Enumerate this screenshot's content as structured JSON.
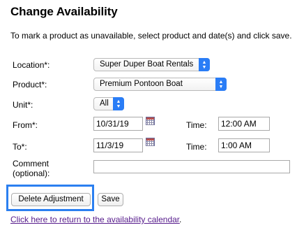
{
  "title": "Change Availability",
  "instructions": "To mark a product as unavailable, select product and date(s) and click save.",
  "form": {
    "location": {
      "label": "Location*:",
      "value": "Super Duper Boat Rentals"
    },
    "product": {
      "label": "Product*:",
      "value": "Premium Pontoon Boat"
    },
    "unit": {
      "label": "Unit*:",
      "value": "All"
    },
    "from": {
      "label": "From*:",
      "date": "10/31/19",
      "time_label": "Time:",
      "time": "12:00 AM"
    },
    "to": {
      "label": "To*:",
      "date": "11/3/19",
      "time_label": "Time:",
      "time": "1:00 AM"
    },
    "comment": {
      "label_line1": "Comment",
      "label_line2": "(optional):",
      "value": ""
    }
  },
  "buttons": {
    "delete_label": "Delete Adjustment",
    "save_label": "Save"
  },
  "footer": {
    "link_text": "Click here to return to the availability calendar",
    "trailing": "."
  },
  "colors": {
    "highlight": "#2b7ff0",
    "select_arrow": "#2a7df6",
    "link": "#551a8b"
  },
  "icons": [
    "calendar-icon",
    "select-arrows-icon"
  ]
}
